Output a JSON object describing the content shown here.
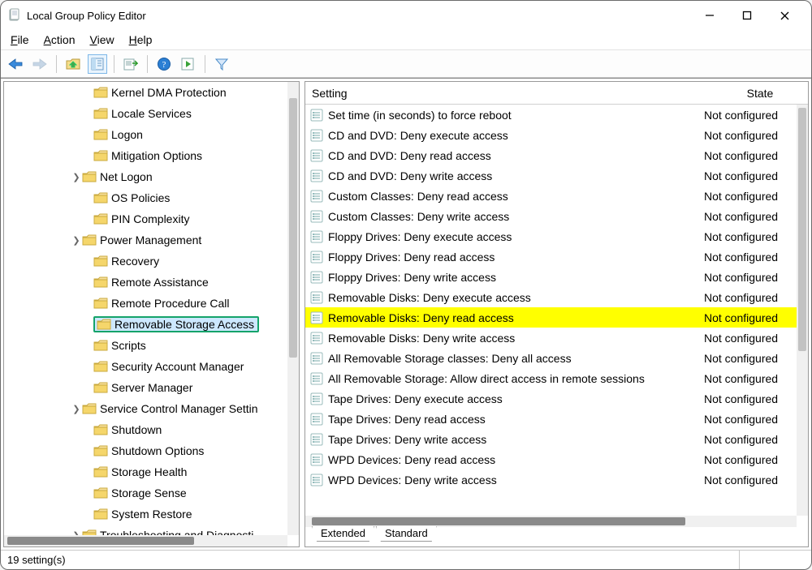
{
  "titlebar": {
    "title": "Local Group Policy Editor"
  },
  "menubar": {
    "file": "File",
    "action": "Action",
    "view": "View",
    "help": "Help"
  },
  "tree": {
    "items": [
      {
        "label": "Kernel DMA Protection",
        "indent": 96,
        "chevron": ""
      },
      {
        "label": "Locale Services",
        "indent": 96,
        "chevron": ""
      },
      {
        "label": "Logon",
        "indent": 96,
        "chevron": ""
      },
      {
        "label": "Mitigation Options",
        "indent": 96,
        "chevron": ""
      },
      {
        "label": "Net Logon",
        "indent": 82,
        "chevron": ">"
      },
      {
        "label": "OS Policies",
        "indent": 96,
        "chevron": ""
      },
      {
        "label": "PIN Complexity",
        "indent": 96,
        "chevron": ""
      },
      {
        "label": "Power Management",
        "indent": 82,
        "chevron": ">"
      },
      {
        "label": "Recovery",
        "indent": 96,
        "chevron": ""
      },
      {
        "label": "Remote Assistance",
        "indent": 96,
        "chevron": ""
      },
      {
        "label": "Remote Procedure Call",
        "indent": 96,
        "chevron": ""
      },
      {
        "label": "Removable Storage Access",
        "indent": 96,
        "chevron": "",
        "selected": true
      },
      {
        "label": "Scripts",
        "indent": 96,
        "chevron": ""
      },
      {
        "label": "Security Account Manager",
        "indent": 96,
        "chevron": ""
      },
      {
        "label": "Server Manager",
        "indent": 96,
        "chevron": ""
      },
      {
        "label": "Service Control Manager Settin",
        "indent": 82,
        "chevron": ">"
      },
      {
        "label": "Shutdown",
        "indent": 96,
        "chevron": ""
      },
      {
        "label": "Shutdown Options",
        "indent": 96,
        "chevron": ""
      },
      {
        "label": "Storage Health",
        "indent": 96,
        "chevron": ""
      },
      {
        "label": "Storage Sense",
        "indent": 96,
        "chevron": ""
      },
      {
        "label": "System Restore",
        "indent": 96,
        "chevron": ""
      },
      {
        "label": "Troubleshooting and Diagnosti",
        "indent": 82,
        "chevron": ">"
      }
    ]
  },
  "list": {
    "header": {
      "setting": "Setting",
      "state": "State"
    },
    "rows": [
      {
        "setting": "Set time (in seconds) to force reboot",
        "state": "Not configured"
      },
      {
        "setting": "CD and DVD: Deny execute access",
        "state": "Not configured"
      },
      {
        "setting": "CD and DVD: Deny read access",
        "state": "Not configured"
      },
      {
        "setting": "CD and DVD: Deny write access",
        "state": "Not configured"
      },
      {
        "setting": "Custom Classes: Deny read access",
        "state": "Not configured"
      },
      {
        "setting": "Custom Classes: Deny write access",
        "state": "Not configured"
      },
      {
        "setting": "Floppy Drives: Deny execute access",
        "state": "Not configured"
      },
      {
        "setting": "Floppy Drives: Deny read access",
        "state": "Not configured"
      },
      {
        "setting": "Floppy Drives: Deny write access",
        "state": "Not configured"
      },
      {
        "setting": "Removable Disks: Deny execute access",
        "state": "Not configured"
      },
      {
        "setting": "Removable Disks: Deny read access",
        "state": "Not configured",
        "highlight": true
      },
      {
        "setting": "Removable Disks: Deny write access",
        "state": "Not configured"
      },
      {
        "setting": "All Removable Storage classes: Deny all access",
        "state": "Not configured"
      },
      {
        "setting": "All Removable Storage: Allow direct access in remote sessions",
        "state": "Not configured"
      },
      {
        "setting": "Tape Drives: Deny execute access",
        "state": "Not configured"
      },
      {
        "setting": "Tape Drives: Deny read access",
        "state": "Not configured"
      },
      {
        "setting": "Tape Drives: Deny write access",
        "state": "Not configured"
      },
      {
        "setting": "WPD Devices: Deny read access",
        "state": "Not configured"
      },
      {
        "setting": "WPD Devices: Deny write access",
        "state": "Not configured"
      }
    ]
  },
  "tabs": {
    "extended": "Extended",
    "standard": "Standard"
  },
  "status": {
    "text": "19 setting(s)"
  }
}
